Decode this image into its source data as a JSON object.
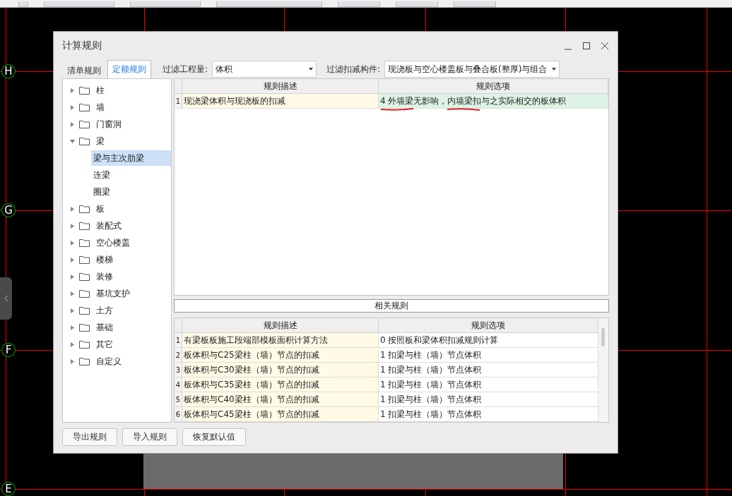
{
  "canvas": {
    "axes": [
      "H",
      "G",
      "F",
      "E"
    ]
  },
  "dialog": {
    "title": "计算规则",
    "tabs": [
      {
        "label": "清单规则",
        "selected": false
      },
      {
        "label": "定额规则",
        "selected": true
      }
    ],
    "filters": [
      {
        "label": "过滤工程量:",
        "value": "体积"
      },
      {
        "label": "过滤扣减构件:",
        "value": "现浇板与空心楼盖板与叠合板(整厚)与组合"
      }
    ],
    "tree": [
      {
        "label": "柱",
        "expanded": false
      },
      {
        "label": "墙",
        "expanded": false
      },
      {
        "label": "门窗洞",
        "expanded": false
      },
      {
        "label": "梁",
        "expanded": true,
        "children": [
          {
            "label": "梁与主次肋梁",
            "selected": true
          },
          {
            "label": "连梁",
            "selected": false
          },
          {
            "label": "圈梁",
            "selected": false
          }
        ]
      },
      {
        "label": "板",
        "expanded": false
      },
      {
        "label": "装配式",
        "expanded": false
      },
      {
        "label": "空心楼盖",
        "expanded": false
      },
      {
        "label": "楼梯",
        "expanded": false
      },
      {
        "label": "装修",
        "expanded": false
      },
      {
        "label": "基坑支护",
        "expanded": false
      },
      {
        "label": "土方",
        "expanded": false
      },
      {
        "label": "基础",
        "expanded": false
      },
      {
        "label": "其它",
        "expanded": false
      },
      {
        "label": "自定义",
        "expanded": false
      }
    ],
    "rules": {
      "columns": [
        "规则描述",
        "规则选项"
      ],
      "rows": [
        {
          "index": "1",
          "description": "现浇梁体积与现浇板的扣减",
          "option": "4 外墙梁无影响，内墙梁扣与之实际相交的板体积",
          "selected": true
        }
      ]
    },
    "related_rules": {
      "title": "相关规则",
      "columns": [
        "规则描述",
        "规则选项"
      ],
      "rows": [
        {
          "index": "1",
          "description": "有梁板板施工段端部模板面积计算方法",
          "option": "0 按照板和梁体积扣减规则计算",
          "selected": false
        },
        {
          "index": "2",
          "description": "板体积与C25梁柱（墙）节点的扣减",
          "option": "1 扣梁与柱（墙）节点体积",
          "selected": false
        },
        {
          "index": "3",
          "description": "板体积与C30梁柱（墙）节点的扣减",
          "option": "1 扣梁与柱（墙）节点体积",
          "selected": false
        },
        {
          "index": "4",
          "description": "板体积与C35梁柱（墙）节点的扣减",
          "option": "1 扣梁与柱（墙）节点体积",
          "selected": false
        },
        {
          "index": "5",
          "description": "板体积与C40梁柱（墙）节点的扣减",
          "option": "1 扣梁与柱（墙）节点体积",
          "selected": false
        },
        {
          "index": "6",
          "description": "板体积与C45梁柱（墙）节点的扣减",
          "option": "1 扣梁与柱（墙）节点体积",
          "selected": false
        }
      ]
    },
    "buttons": [
      "导出规则",
      "导入规则",
      "恢复默认值"
    ]
  }
}
